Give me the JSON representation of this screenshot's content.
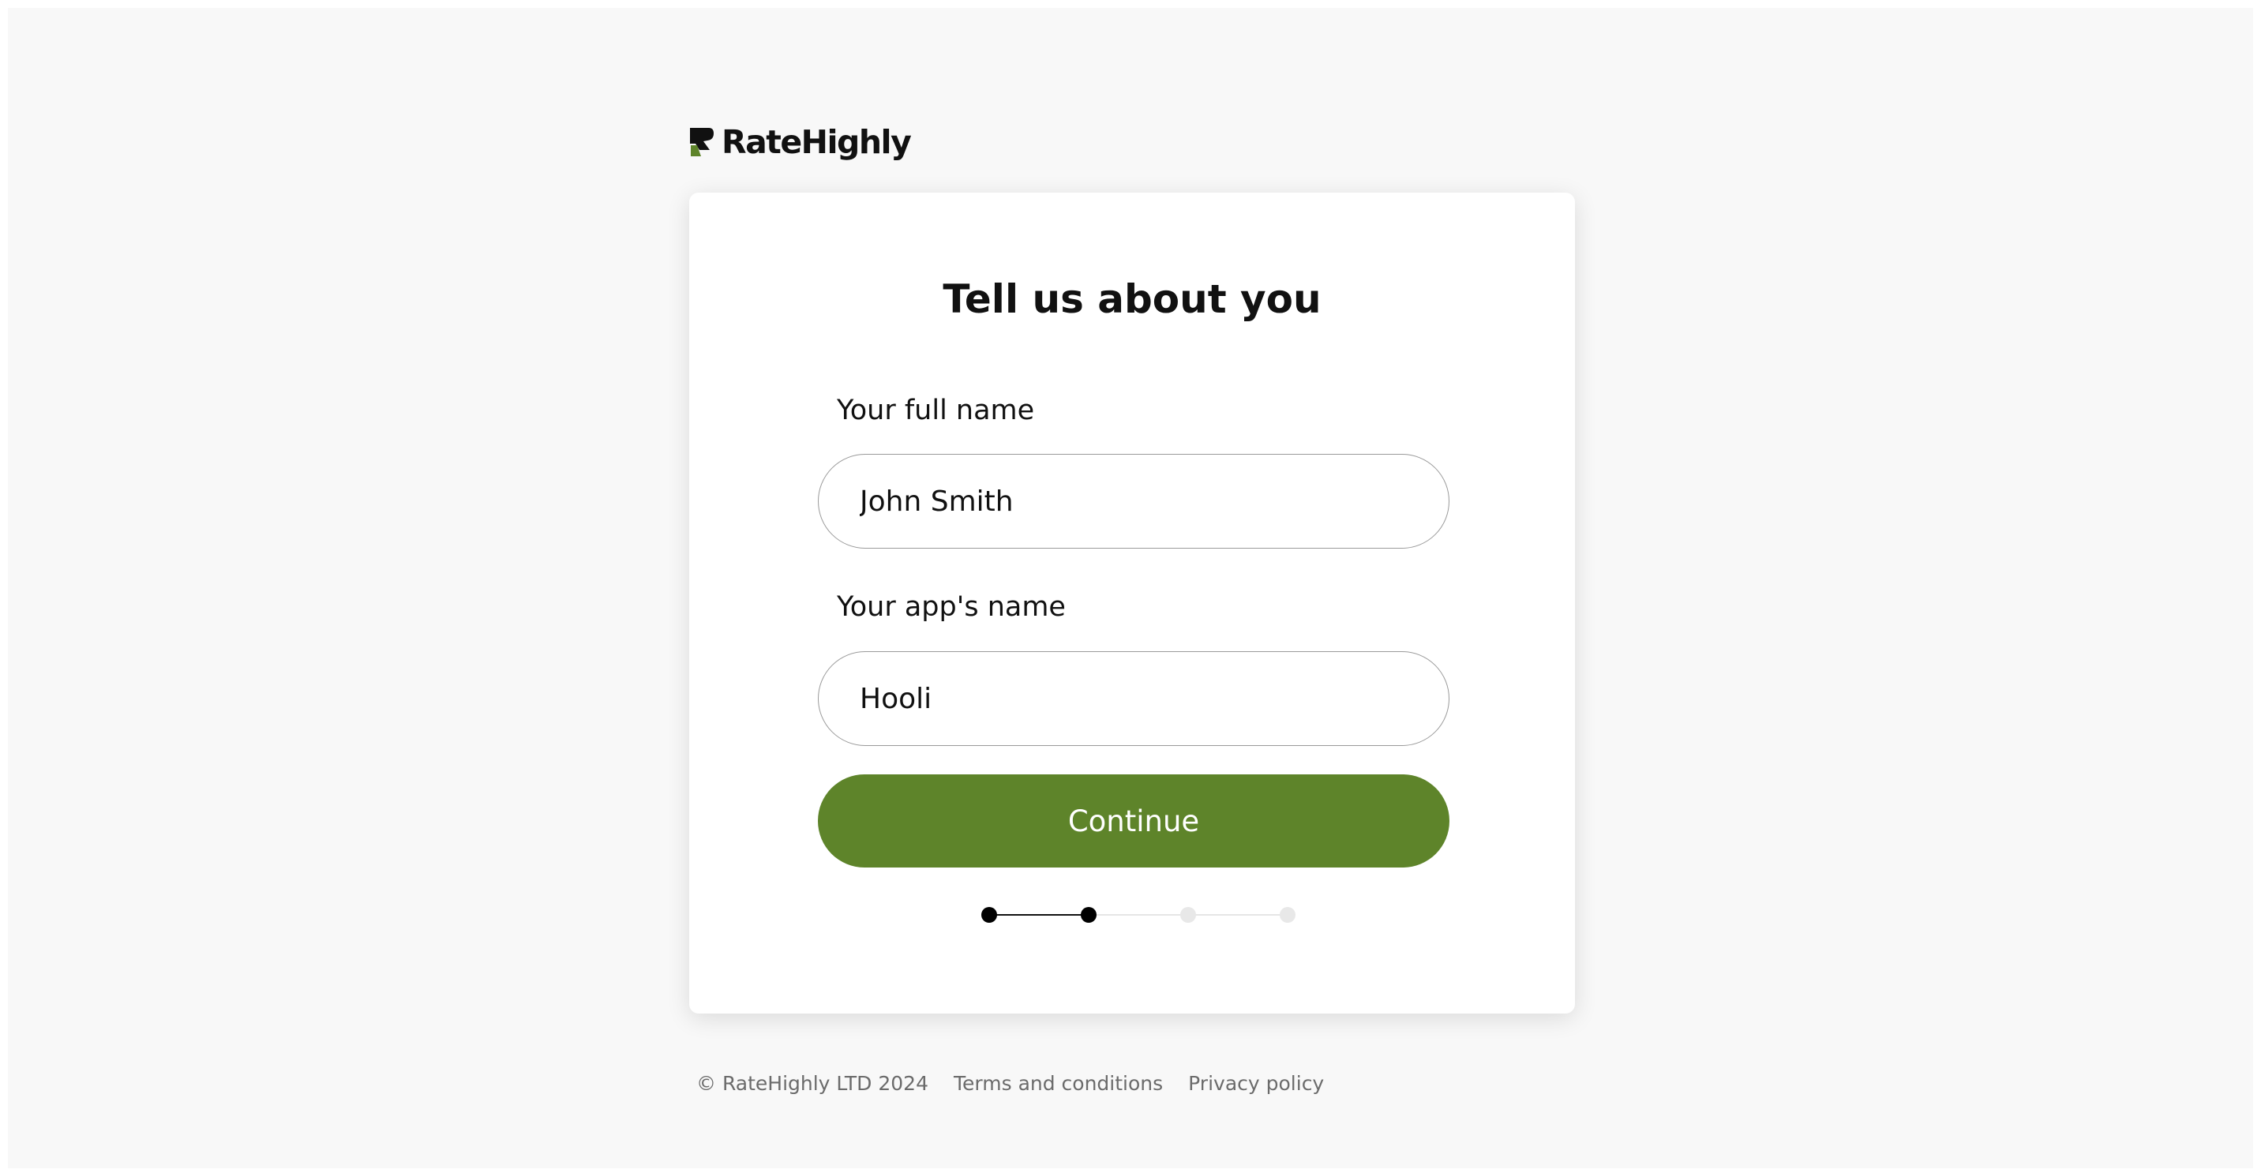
{
  "brand": {
    "name": "RateHighly",
    "logo_icon": "ratehighly-r-mark",
    "colors": {
      "accent": "#5e842a",
      "logo_dark": "#111111",
      "logo_green": "#5e842a"
    }
  },
  "card": {
    "title": "Tell us about you",
    "fields": {
      "full_name": {
        "label": "Your full name",
        "value": "John Smith"
      },
      "app_name": {
        "label": "Your app's name",
        "value": "Hooli"
      }
    },
    "continue_label": "Continue",
    "progress": {
      "total_steps": 4,
      "current_step": 2
    }
  },
  "footer": {
    "copyright": "© RateHighly LTD 2024",
    "terms": "Terms and conditions",
    "privacy": "Privacy policy"
  }
}
